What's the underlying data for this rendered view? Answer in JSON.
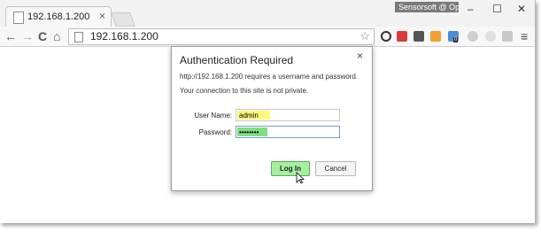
{
  "browser": {
    "tab_title": "192.168.1.200",
    "tab_close": "×",
    "profile_label": "Sensorsoft @ Opto...",
    "address": "192.168.1.200",
    "window_controls": {
      "minimize": "–",
      "maximize": "☐",
      "close": "✕"
    },
    "nav": {
      "back": "←",
      "forward": "→",
      "reload": "C",
      "home": "⌂"
    },
    "star": "☆",
    "menu": "≡",
    "extension_icons": [
      "info-icon",
      "red-extension-icon",
      "puzzle-icon",
      "orange-extension-icon",
      "lock-badge-icon",
      "moon-icon",
      "circle-icon",
      "arrow-icon"
    ],
    "extension_badge": "0"
  },
  "auth_dialog": {
    "title": "Authentication Required",
    "message": "http://192.168.1.200 requires a username and password.",
    "privacy_note": "Your connection to this site is not private.",
    "username_label": "User Name:",
    "username_value": "admin",
    "password_label": "Password:",
    "password_value": "••••••••",
    "login_button": "Log In",
    "cancel_button": "Cancel",
    "close": "×"
  }
}
